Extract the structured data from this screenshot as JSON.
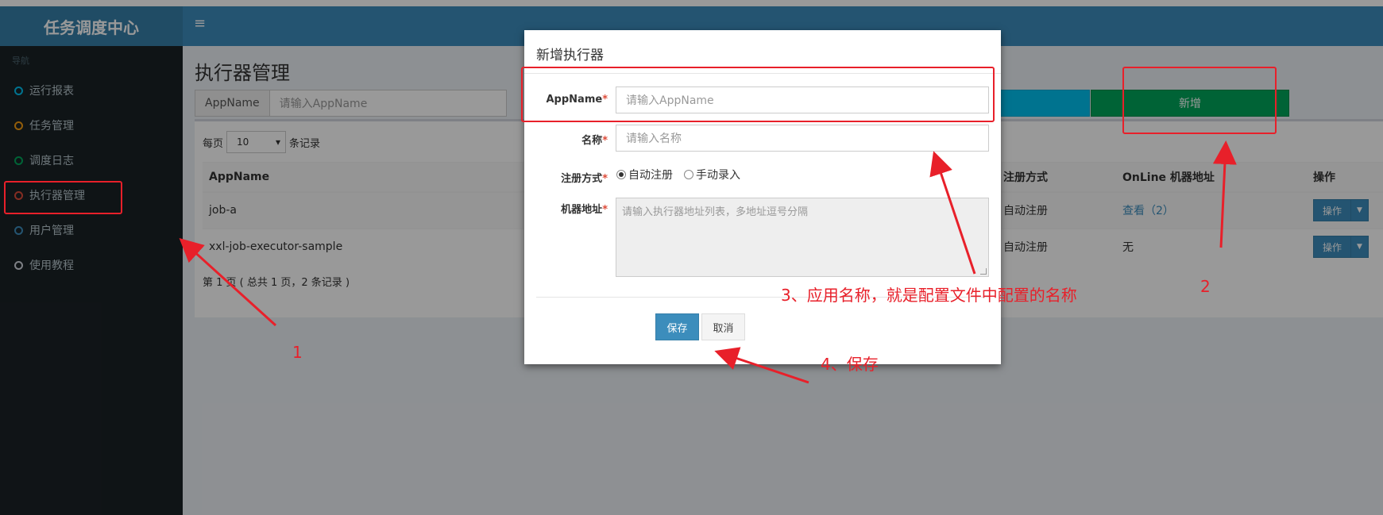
{
  "sidebar": {
    "logo": "任务调度中心",
    "nav_header": "导航",
    "items": [
      {
        "label": "运行报表",
        "color": "#00c0ef"
      },
      {
        "label": "任务管理",
        "color": "#f39c12"
      },
      {
        "label": "调度日志",
        "color": "#00a65a"
      },
      {
        "label": "执行器管理",
        "color": "#dd4b39"
      },
      {
        "label": "用户管理",
        "color": "#3c8dbc"
      },
      {
        "label": "使用教程",
        "color": "#d2d6de"
      }
    ]
  },
  "header": {
    "menu_icon": "≡"
  },
  "main": {
    "title": "执行器管理",
    "search": {
      "label": "AppName",
      "placeholder": "请输入AppName"
    },
    "add_button": "新增",
    "page_size": {
      "prefix": "每页",
      "value": "10",
      "suffix": "条记录"
    },
    "table": {
      "headers": [
        "AppName",
        "注册方式",
        "OnLine 机器地址",
        "操作"
      ],
      "rows": [
        {
          "appname": "job-a",
          "reg": "自动注册",
          "online": "查看（2）",
          "op": "操作"
        },
        {
          "appname": "xxl-job-executor-sample",
          "reg": "自动注册",
          "online": "无",
          "op": "操作"
        }
      ]
    },
    "pagination_info": "第 1 页 ( 总共 1 页，2 条记录 )"
  },
  "modal": {
    "title": "新增执行器",
    "appname_label": "AppName",
    "appname_placeholder": "请输入AppName",
    "name_label": "名称",
    "name_placeholder": "请输入名称",
    "reg_label": "注册方式",
    "reg_options": [
      "自动注册",
      "手动录入"
    ],
    "reg_selected": "自动注册",
    "address_label": "机器地址",
    "address_placeholder": "请输入执行器地址列表，多地址逗号分隔",
    "required_mark": "*",
    "save_label": "保存",
    "cancel_label": "取消"
  },
  "annotations": {
    "label1": "1",
    "label2": "2",
    "label3": "3、应用名称，就是配置文件中配置的名称",
    "label4": "4、保存",
    "color": "#e8202a"
  }
}
